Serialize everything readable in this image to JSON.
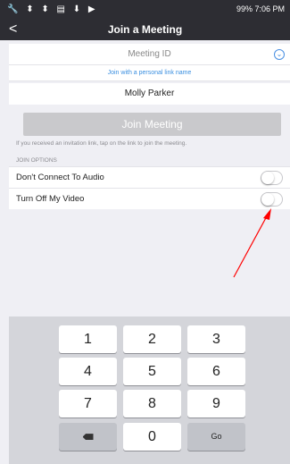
{
  "status_bar": {
    "left_icons": "🔧 ⬍ ⬍ ▤ ⬇ ▶",
    "right_text": "99% 7:06 PM"
  },
  "nav": {
    "back_icon": "chevron-left-icon",
    "back_glyph": "<",
    "title": "Join a Meeting"
  },
  "form": {
    "meeting_id_placeholder": "Meeting ID",
    "dropdown_glyph": "⌄",
    "personal_link_text": "Join with a personal link name",
    "name_value": "Molly Parker",
    "join_button_label": "Join Meeting",
    "hint": "If you received an invitation link, tap on the link to join the meeting."
  },
  "join_options": {
    "section_title": "JOIN OPTIONS",
    "items": [
      {
        "label": "Don't Connect To Audio",
        "checked": false
      },
      {
        "label": "Turn Off My Video",
        "checked": false
      }
    ]
  },
  "annotation": {
    "arrow_color": "#ff0000"
  },
  "keypad": {
    "rows": [
      [
        "1",
        "2",
        "3"
      ],
      [
        "4",
        "5",
        "6"
      ],
      [
        "7",
        "8",
        "9"
      ],
      [
        "",
        "0",
        "Go"
      ]
    ]
  }
}
